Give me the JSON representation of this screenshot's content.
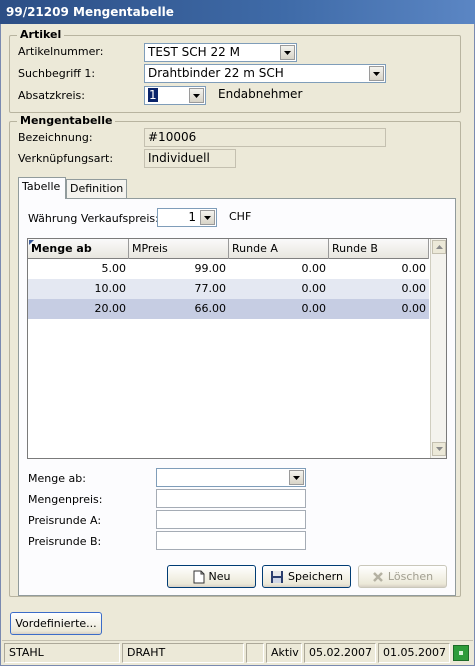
{
  "window": {
    "title": "99/21209 Mengentabelle"
  },
  "artikel": {
    "group_label": "Artikel",
    "artikelnummer_label": "Artikelnummer:",
    "artikelnummer_value": "TEST SCH 22 M",
    "suchbegriff_label": "Suchbegriff 1:",
    "suchbegriff_value": "Drahtbinder 22 m SCH",
    "absatzkreis_label": "Absatzkreis:",
    "absatzkreis_value": "1",
    "absatzkreis_text": "Endabnehmer"
  },
  "mengentabelle": {
    "group_label": "Mengentabelle",
    "bezeichnung_label": "Bezeichnung:",
    "bezeichnung_value": "#10006",
    "verknuepfung_label": "Verknüpfungsart:",
    "verknuepfung_value": "Individuell"
  },
  "tabs": [
    {
      "label": "Tabelle",
      "active": true
    },
    {
      "label": "Definition",
      "active": false
    }
  ],
  "tabelle": {
    "waehrung_label": "Währung Verkaufspreis:",
    "waehrung_value": "1",
    "waehrung_text": "CHF",
    "columns": [
      "Menge ab",
      "MPreis",
      "Runde A",
      "Runde B"
    ],
    "rows": [
      [
        "5.00",
        "99.00",
        "0.00",
        "0.00"
      ],
      [
        "10.00",
        "77.00",
        "0.00",
        "0.00"
      ],
      [
        "20.00",
        "66.00",
        "0.00",
        "0.00"
      ]
    ],
    "selected_row": 2
  },
  "form": {
    "menge_label": "Menge ab:",
    "mengenpreis_label": "Mengenpreis:",
    "preisrunde_a_label": "Preisrunde A:",
    "preisrunde_b_label": "Preisrunde B:"
  },
  "buttons": {
    "neu": "Neu",
    "speichern": "Speichern",
    "loeschen": "Löschen",
    "vordefinierte": "Vordefinierte..."
  },
  "statusbar": {
    "user": "STAHL",
    "context": "DRAHT",
    "empty": "",
    "status": "Aktiv",
    "date1": "05.02.2007",
    "date2": "01.05.2007"
  },
  "colors": {
    "title_bar": "#3f6ba8",
    "row_alt": "#e4e8f2",
    "row_selected": "#c6cde3"
  }
}
